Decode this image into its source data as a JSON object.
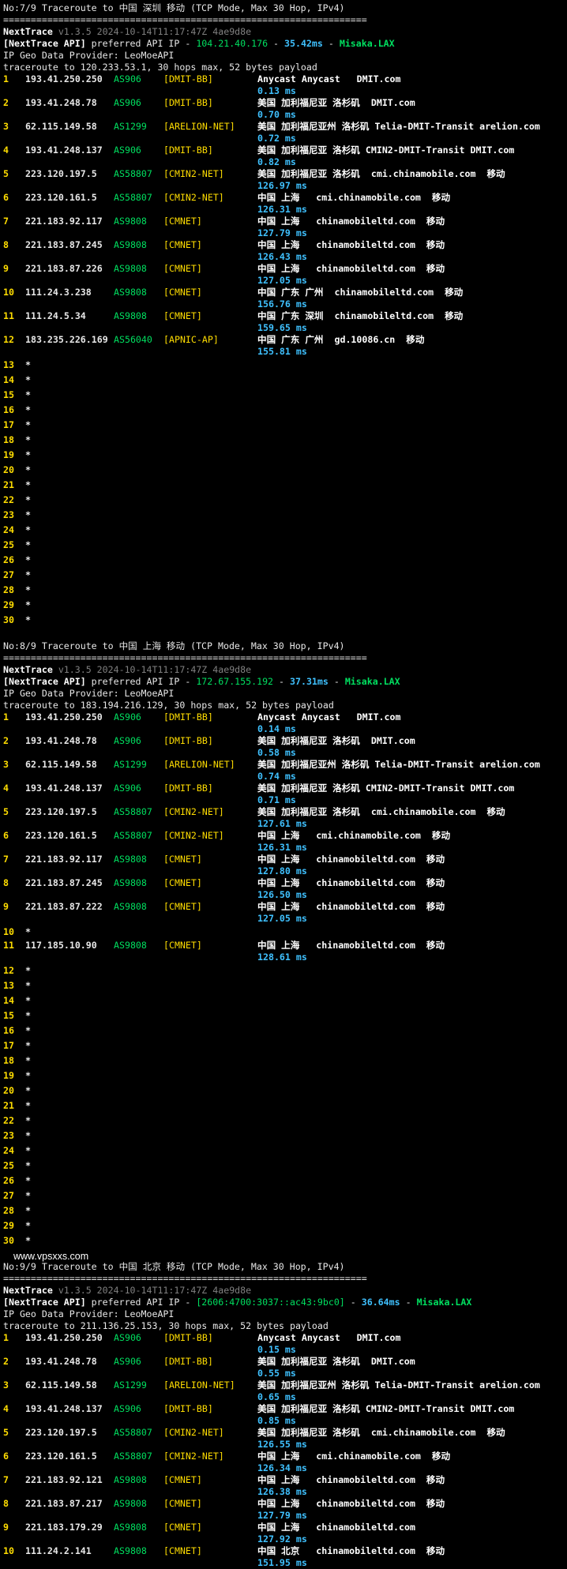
{
  "sections": [
    {
      "title": "No:7/9 Traceroute to 中国 深圳 移动 (TCP Mode, Max 30 Hop, IPv4)",
      "separator": "==================================================================",
      "app_name": "NextTrace",
      "version": "v1.3.5 2024-10-14T11:17:47Z 4ae9d8e",
      "api_prefix": "[NextTrace API]",
      "api_label": " preferred API IP - ",
      "api_ip": "104.21.40.176",
      "api_ms": "35.42ms",
      "api_dash": " - ",
      "api_node": "Misaka.LAX",
      "geo_provider": "IP Geo Data Provider: LeoMoeAPI",
      "traceroute_line": "traceroute to 120.233.53.1, 30 hops max, 52 bytes payload",
      "hops": [
        {
          "num": "1",
          "ip": "193.41.250.250",
          "asn": "AS906",
          "tag": "[DMIT-BB]",
          "geo": "Anycast Anycast   DMIT.com",
          "latency": "0.13 ms"
        },
        {
          "num": "2",
          "ip": "193.41.248.78",
          "asn": "AS906",
          "tag": "[DMIT-BB]",
          "geo": "美国 加利福尼亚 洛杉矶  DMIT.com",
          "latency": "0.70 ms"
        },
        {
          "num": "3",
          "ip": "62.115.149.58",
          "asn": "AS1299",
          "tag": "[ARELION-NET]",
          "geo": "美国 加利福尼亚州 洛杉矶 Telia-DMIT-Transit arelion.com",
          "latency": "0.72 ms"
        },
        {
          "num": "4",
          "ip": "193.41.248.137",
          "asn": "AS906",
          "tag": "[DMIT-BB]",
          "geo": "美国 加利福尼亚 洛杉矶 CMIN2-DMIT-Transit DMIT.com",
          "latency": "0.82 ms"
        },
        {
          "num": "5",
          "ip": "223.120.197.5",
          "asn": "AS58807",
          "tag": "[CMIN2-NET]",
          "geo": "美国 加利福尼亚 洛杉矶  cmi.chinamobile.com  移动",
          "latency": "126.97 ms"
        },
        {
          "num": "6",
          "ip": "223.120.161.5",
          "asn": "AS58807",
          "tag": "[CMIN2-NET]",
          "geo": "中国 上海   cmi.chinamobile.com  移动",
          "latency": "126.31 ms"
        },
        {
          "num": "7",
          "ip": "221.183.92.117",
          "asn": "AS9808",
          "tag": "[CMNET]",
          "geo": "中国 上海   chinamobileltd.com  移动",
          "latency": "127.79 ms"
        },
        {
          "num": "8",
          "ip": "221.183.87.245",
          "asn": "AS9808",
          "tag": "[CMNET]",
          "geo": "中国 上海   chinamobileltd.com  移动",
          "latency": "126.43 ms"
        },
        {
          "num": "9",
          "ip": "221.183.87.226",
          "asn": "AS9808",
          "tag": "[CMNET]",
          "geo": "中国 上海   chinamobileltd.com  移动",
          "latency": "127.05 ms"
        },
        {
          "num": "10",
          "ip": "111.24.3.238",
          "asn": "AS9808",
          "tag": "[CMNET]",
          "geo": "中国 广东 广州  chinamobileltd.com  移动",
          "latency": "156.76 ms"
        },
        {
          "num": "11",
          "ip": "111.24.5.34",
          "asn": "AS9808",
          "tag": "[CMNET]",
          "geo": "中国 广东 深圳  chinamobileltd.com  移动",
          "latency": "159.65 ms"
        },
        {
          "num": "12",
          "ip": "183.235.226.169",
          "asn": "AS56040",
          "tag": "[APNIC-AP]",
          "geo": "中国 广东 广州  gd.10086.cn  移动",
          "latency": "155.81 ms"
        }
      ],
      "stars": [
        "13",
        "14",
        "15",
        "16",
        "17",
        "18",
        "19",
        "20",
        "21",
        "22",
        "23",
        "24",
        "25",
        "26",
        "27",
        "28",
        "29",
        "30"
      ]
    },
    {
      "title": "No:8/9 Traceroute to 中国 上海 移动 (TCP Mode, Max 30 Hop, IPv4)",
      "separator": "==================================================================",
      "app_name": "NextTrace",
      "version": "v1.3.5 2024-10-14T11:17:47Z 4ae9d8e",
      "api_prefix": "[NextTrace API]",
      "api_label": " preferred API IP - ",
      "api_ip": "172.67.155.192",
      "api_ms": "37.31ms",
      "api_dash": " - ",
      "api_node": "Misaka.LAX",
      "geo_provider": "IP Geo Data Provider: LeoMoeAPI",
      "traceroute_line": "traceroute to 183.194.216.129, 30 hops max, 52 bytes payload",
      "hops": [
        {
          "num": "1",
          "ip": "193.41.250.250",
          "asn": "AS906",
          "tag": "[DMIT-BB]",
          "geo": "Anycast Anycast   DMIT.com",
          "latency": "0.14 ms"
        },
        {
          "num": "2",
          "ip": "193.41.248.78",
          "asn": "AS906",
          "tag": "[DMIT-BB]",
          "geo": "美国 加利福尼亚 洛杉矶  DMIT.com",
          "latency": "0.58 ms"
        },
        {
          "num": "3",
          "ip": "62.115.149.58",
          "asn": "AS1299",
          "tag": "[ARELION-NET]",
          "geo": "美国 加利福尼亚州 洛杉矶 Telia-DMIT-Transit arelion.com",
          "latency": "0.74 ms"
        },
        {
          "num": "4",
          "ip": "193.41.248.137",
          "asn": "AS906",
          "tag": "[DMIT-BB]",
          "geo": "美国 加利福尼亚 洛杉矶 CMIN2-DMIT-Transit DMIT.com",
          "latency": "0.71 ms"
        },
        {
          "num": "5",
          "ip": "223.120.197.5",
          "asn": "AS58807",
          "tag": "[CMIN2-NET]",
          "geo": "美国 加利福尼亚 洛杉矶  cmi.chinamobile.com  移动",
          "latency": "127.61 ms"
        },
        {
          "num": "6",
          "ip": "223.120.161.5",
          "asn": "AS58807",
          "tag": "[CMIN2-NET]",
          "geo": "中国 上海   cmi.chinamobile.com  移动",
          "latency": "126.31 ms"
        },
        {
          "num": "7",
          "ip": "221.183.92.117",
          "asn": "AS9808",
          "tag": "[CMNET]",
          "geo": "中国 上海   chinamobileltd.com  移动",
          "latency": "127.80 ms"
        },
        {
          "num": "8",
          "ip": "221.183.87.245",
          "asn": "AS9808",
          "tag": "[CMNET]",
          "geo": "中国 上海   chinamobileltd.com  移动",
          "latency": "126.50 ms"
        },
        {
          "num": "9",
          "ip": "221.183.87.222",
          "asn": "AS9808",
          "tag": "[CMNET]",
          "geo": "中国 上海   chinamobileltd.com  移动",
          "latency": "127.05 ms"
        }
      ],
      "star_mid": "10",
      "hops_after": [
        {
          "num": "11",
          "ip": "117.185.10.90",
          "asn": "AS9808",
          "tag": "[CMNET]",
          "geo": "中国 上海   chinamobileltd.com  移动",
          "latency": "128.61 ms"
        }
      ],
      "stars": [
        "12",
        "13",
        "14",
        "15",
        "16",
        "17",
        "18",
        "19",
        "20",
        "21",
        "22",
        "23",
        "24",
        "25",
        "26",
        "27",
        "28",
        "29",
        "30"
      ]
    },
    {
      "title": "No:9/9 Traceroute to 中国 北京 移动 (TCP Mode, Max 30 Hop, IPv4)",
      "separator": "==================================================================",
      "app_name": "NextTrace",
      "version": "v1.3.5 2024-10-14T11:17:47Z 4ae9d8e",
      "api_prefix": "[NextTrace API]",
      "api_label": " preferred API IP - ",
      "api_ip": "[2606:4700:3037::ac43:9bc0]",
      "api_ms": "36.64ms",
      "api_dash": " - ",
      "api_node": "Misaka.LAX",
      "geo_provider": "IP Geo Data Provider: LeoMoeAPI",
      "traceroute_line": "traceroute to 211.136.25.153, 30 hops max, 52 bytes payload",
      "hops": [
        {
          "num": "1",
          "ip": "193.41.250.250",
          "asn": "AS906",
          "tag": "[DMIT-BB]",
          "geo": "Anycast Anycast   DMIT.com",
          "latency": "0.15 ms"
        },
        {
          "num": "2",
          "ip": "193.41.248.78",
          "asn": "AS906",
          "tag": "[DMIT-BB]",
          "geo": "美国 加利福尼亚 洛杉矶  DMIT.com",
          "latency": "0.55 ms"
        },
        {
          "num": "3",
          "ip": "62.115.149.58",
          "asn": "AS1299",
          "tag": "[ARELION-NET]",
          "geo": "美国 加利福尼亚州 洛杉矶 Telia-DMIT-Transit arelion.com",
          "latency": "0.65 ms"
        },
        {
          "num": "4",
          "ip": "193.41.248.137",
          "asn": "AS906",
          "tag": "[DMIT-BB]",
          "geo": "美国 加利福尼亚 洛杉矶 CMIN2-DMIT-Transit DMIT.com",
          "latency": "0.85 ms"
        },
        {
          "num": "5",
          "ip": "223.120.197.5",
          "asn": "AS58807",
          "tag": "[CMIN2-NET]",
          "geo": "美国 加利福尼亚 洛杉矶  cmi.chinamobile.com  移动",
          "latency": "126.55 ms"
        },
        {
          "num": "6",
          "ip": "223.120.161.5",
          "asn": "AS58807",
          "tag": "[CMIN2-NET]",
          "geo": "中国 上海   cmi.chinamobile.com  移动",
          "latency": "126.34 ms"
        },
        {
          "num": "7",
          "ip": "221.183.92.121",
          "asn": "AS9808",
          "tag": "[CMNET]",
          "geo": "中国 上海   chinamobileltd.com  移动",
          "latency": "126.38 ms"
        },
        {
          "num": "8",
          "ip": "221.183.87.217",
          "asn": "AS9808",
          "tag": "[CMNET]",
          "geo": "中国 上海   chinamobileltd.com  移动",
          "latency": "127.79 ms"
        },
        {
          "num": "9",
          "ip": "221.183.179.29",
          "asn": "AS9808",
          "tag": "[CMNET]",
          "geo": "中国 上海   chinamobileltd.com",
          "latency": "127.92 ms"
        },
        {
          "num": "10",
          "ip": "111.24.2.141",
          "asn": "AS9808",
          "tag": "[CMNET]",
          "geo": "中国 北京   chinamobileltd.com  移动",
          "latency": "151.95 ms"
        }
      ],
      "stars": []
    }
  ],
  "watermark": "www.vpsxxs.com",
  "star_symbol": "*",
  "colors": {
    "background": "#000000",
    "hop_number": "#ffdd00",
    "asn": "#00e060",
    "tag": "#ffdd00",
    "latency": "#3fc1ff",
    "version": "#808080"
  }
}
